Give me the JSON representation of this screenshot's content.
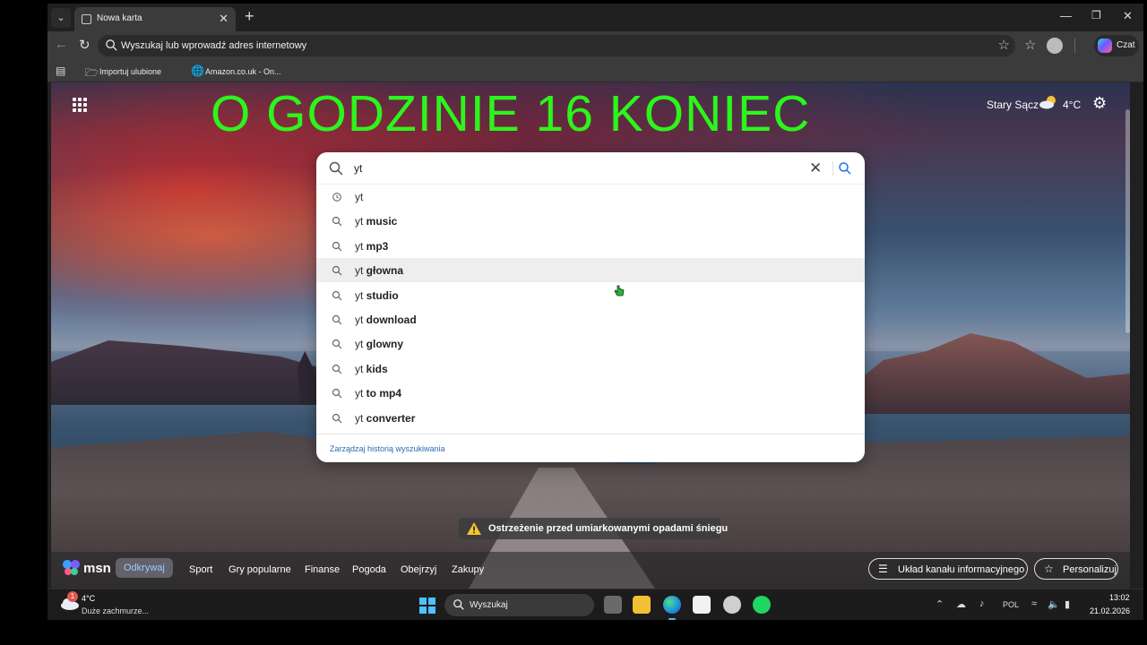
{
  "browser": {
    "tab_title": "Nowa karta",
    "address_placeholder": "Wyszukaj lub wprowadź adres internetowy",
    "copilot_label": "Czat",
    "favorites": [
      {
        "label": "Importuj ulubione",
        "icon": "folder-import-icon"
      },
      {
        "label": "Amazon.co.uk - On...",
        "icon": "globe-icon"
      }
    ]
  },
  "page": {
    "banner_text": "O GODZINIE 16 KONIEC",
    "weather": {
      "city": "Stary Sącz",
      "temp": "4°C",
      "icon": "partly-cloudy-icon"
    }
  },
  "search": {
    "query": "yt",
    "suggestions": [
      {
        "prefix": "yt",
        "bold": "",
        "icon": "history-icon"
      },
      {
        "prefix": "yt",
        "bold": " music",
        "icon": "search-icon"
      },
      {
        "prefix": "yt",
        "bold": " mp3",
        "icon": "search-icon"
      },
      {
        "prefix": "yt",
        "bold": " głowna",
        "icon": "search-icon"
      },
      {
        "prefix": "yt",
        "bold": " studio",
        "icon": "search-icon"
      },
      {
        "prefix": "yt",
        "bold": " download",
        "icon": "search-icon"
      },
      {
        "prefix": "yt",
        "bold": " glowny",
        "icon": "search-icon"
      },
      {
        "prefix": "yt",
        "bold": " kids",
        "icon": "search-icon"
      },
      {
        "prefix": "yt",
        "bold": " to mp4",
        "icon": "search-icon"
      },
      {
        "prefix": "yt",
        "bold": " converter",
        "icon": "search-icon"
      }
    ],
    "highlighted_index": 3,
    "footer_link": "Zarządzaj historią wyszukiwania"
  },
  "alert": {
    "text": "Ostrzeżenie przed umiarkowanymi opadami śniegu"
  },
  "msn": {
    "logo_text": "msn",
    "nav": [
      "Odkrywaj",
      "Sport",
      "Gry popularne",
      "Finanse",
      "Pogoda",
      "Obejrzyj",
      "Zakupy"
    ],
    "active_nav": "Odkrywaj",
    "feed_layout_label": "Układ kanału informacyjnego",
    "personalize_label": "Personalizuj"
  },
  "taskbar": {
    "weather_temp": "4°C",
    "weather_condition": "Duże zachmurze...",
    "weather_badge": "1",
    "search_label": "Wyszukaj",
    "language": "POL",
    "time": "13:02",
    "date": "21.02.2026"
  },
  "colors": {
    "banner": "#2cf51c",
    "accent": "#4cc2ff",
    "link": "#2b6bb5"
  }
}
